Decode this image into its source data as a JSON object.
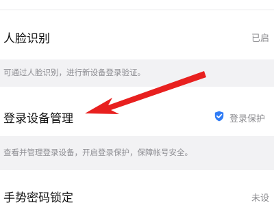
{
  "face_recognition": {
    "title": "人脸识别",
    "status": "已启",
    "hint": "可通过人脸识别，进行新设备登录验证。"
  },
  "device_management": {
    "title": "登录设备管理",
    "status": "登录保护",
    "hint": "查看并管理登录设备，开启登录保护，保障帐号安全。"
  },
  "gesture_lock": {
    "title": "手势密码锁定",
    "status": "未设"
  },
  "icons": {
    "protection": "shield-check-icon",
    "annotation": "red-arrow-annotation"
  },
  "colors": {
    "accent_blue": "#2f7cf6",
    "arrow_red": "#e8201f",
    "background": "#f2f2f4",
    "hint_text": "#8e8e93"
  }
}
